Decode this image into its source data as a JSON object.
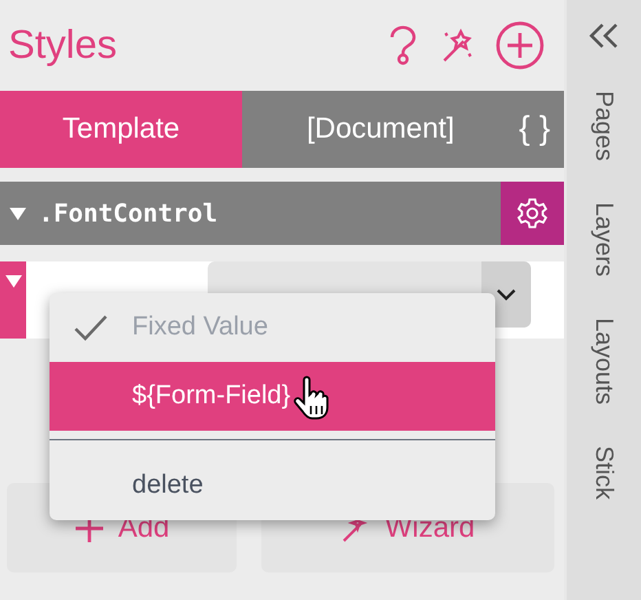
{
  "header": {
    "title": "Styles"
  },
  "tabs": [
    {
      "label": "Template",
      "selected": true
    },
    {
      "label": "[Document]",
      "selected": false
    }
  ],
  "code_button": "{ }",
  "style_group": {
    "name": ".FontControl",
    "expanded": true
  },
  "properties": [
    {
      "expanded": true
    }
  ],
  "buttons": [
    {
      "label": "Add",
      "kind": "add"
    },
    {
      "label": "Wizard",
      "kind": "wizard"
    }
  ],
  "menu": {
    "sections": [
      [
        {
          "label": "Fixed Value",
          "checked": true,
          "selected": false,
          "disabled": true
        },
        {
          "label": "${Form-Field}",
          "checked": false,
          "selected": true,
          "disabled": false
        }
      ],
      [
        {
          "label": "delete",
          "checked": false,
          "selected": false,
          "disabled": false
        }
      ]
    ]
  },
  "sidebar": {
    "tabs": [
      {
        "label": "Pages"
      },
      {
        "label": "Layers"
      },
      {
        "label": "Layouts"
      },
      {
        "label": "Stick"
      }
    ]
  }
}
